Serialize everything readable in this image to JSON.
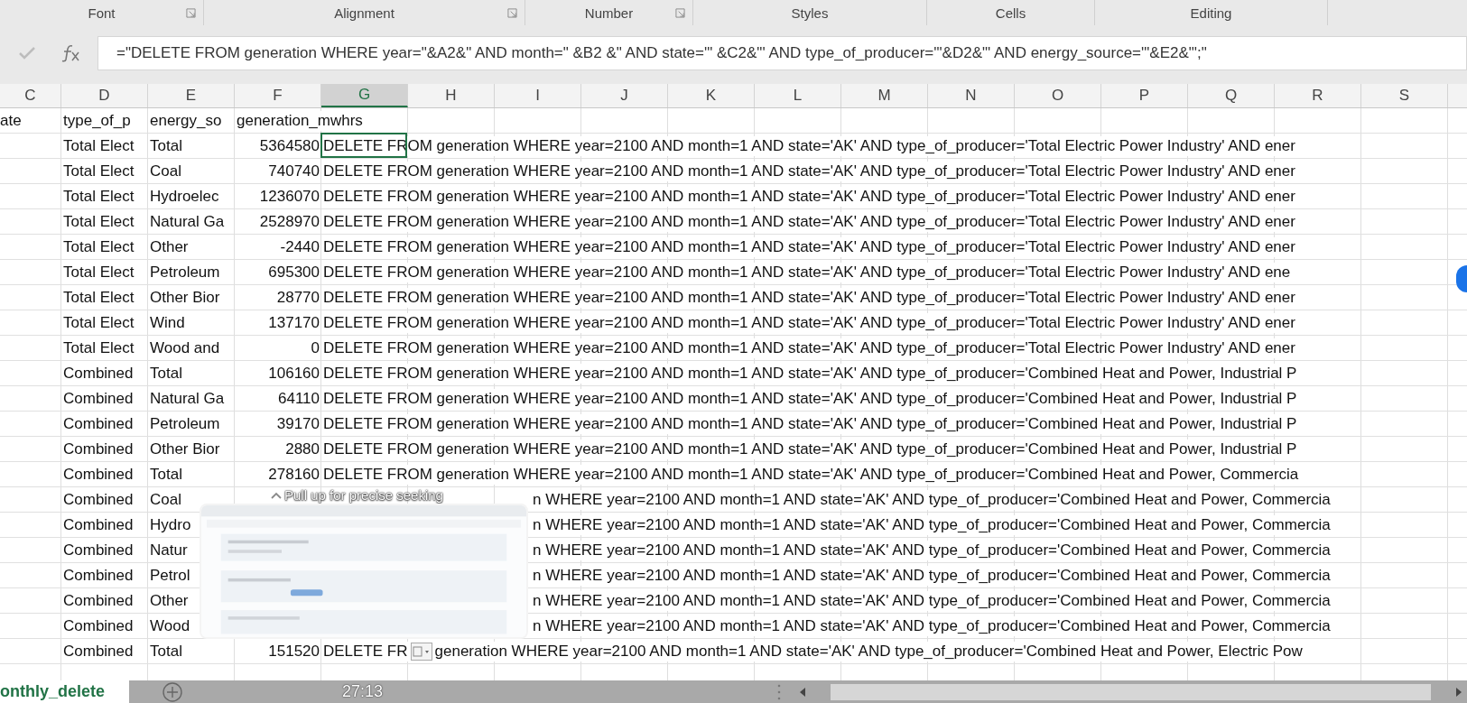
{
  "ribbon_groups": [
    {
      "label": "Font",
      "launcher": true
    },
    {
      "label": "Alignment",
      "launcher": true
    },
    {
      "label": "Number",
      "launcher": true
    },
    {
      "label": "Styles",
      "launcher": false
    },
    {
      "label": "Cells",
      "launcher": false
    },
    {
      "label": "Editing",
      "launcher": false
    }
  ],
  "formula_bar": {
    "formula": "=\"DELETE FROM generation WHERE year=\"&A2&\" AND month=\" &B2 &\" AND state='\" &C2&\"' AND type_of_producer='\"&D2&\"' AND energy_source='\"&E2&\"';\""
  },
  "columns": [
    {
      "label": "C",
      "selected": false
    },
    {
      "label": "D",
      "selected": false
    },
    {
      "label": "E",
      "selected": false
    },
    {
      "label": "F",
      "selected": false
    },
    {
      "label": "G",
      "selected": true
    },
    {
      "label": "H",
      "selected": false
    },
    {
      "label": "I",
      "selected": false
    },
    {
      "label": "J",
      "selected": false
    },
    {
      "label": "K",
      "selected": false
    },
    {
      "label": "L",
      "selected": false
    },
    {
      "label": "M",
      "selected": false
    },
    {
      "label": "N",
      "selected": false
    },
    {
      "label": "O",
      "selected": false
    },
    {
      "label": "P",
      "selected": false
    },
    {
      "label": "Q",
      "selected": false
    },
    {
      "label": "R",
      "selected": false
    },
    {
      "label": "S",
      "selected": false
    }
  ],
  "header_row": [
    "ate",
    "type_of_p",
    "energy_so",
    "generation_mwhrs"
  ],
  "rows": [
    {
      "kind": "plain",
      "producer": "Total Elect",
      "source": "Total",
      "generation": "5364580",
      "sql": "DELETE FROM generation WHERE year=2100 AND month=1 AND state='AK' AND type_of_producer='Total Electric Power Industry' AND ener",
      "selected": true
    },
    {
      "kind": "plain",
      "producer": "Total Elect",
      "source": "Coal",
      "generation": "740740",
      "sql": "DELETE FROM generation WHERE year=2100 AND month=1 AND state='AK' AND type_of_producer='Total Electric Power Industry' AND ener",
      "selected": false
    },
    {
      "kind": "plain",
      "producer": "Total Elect",
      "source": "Hydroelec",
      "generation": "1236070",
      "sql": "DELETE FROM generation WHERE year=2100 AND month=1 AND state='AK' AND type_of_producer='Total Electric Power Industry' AND ener",
      "selected": false
    },
    {
      "kind": "plain",
      "producer": "Total Elect",
      "source": "Natural Ga",
      "generation": "2528970",
      "sql": "DELETE FROM generation WHERE year=2100 AND month=1 AND state='AK' AND type_of_producer='Total Electric Power Industry' AND ener",
      "selected": false
    },
    {
      "kind": "plain",
      "producer": "Total Elect",
      "source": "Other",
      "generation": "-2440",
      "sql": "DELETE FROM generation WHERE year=2100 AND month=1 AND state='AK' AND type_of_producer='Total Electric Power Industry' AND ener",
      "selected": false
    },
    {
      "kind": "plain",
      "producer": "Total Elect",
      "source": "Petroleum",
      "generation": "695300",
      "sql": "DELETE FROM generation WHERE year=2100 AND month=1 AND state='AK' AND type_of_producer='Total Electric Power Industry' AND ene",
      "selected": false
    },
    {
      "kind": "plain",
      "producer": "Total Elect",
      "source": "Other Bior",
      "generation": "28770",
      "sql": "DELETE FROM generation WHERE year=2100 AND month=1 AND state='AK' AND type_of_producer='Total Electric Power Industry' AND ener",
      "selected": false
    },
    {
      "kind": "plain",
      "producer": "Total Elect",
      "source": "Wind",
      "generation": "137170",
      "sql": "DELETE FROM generation WHERE year=2100 AND month=1 AND state='AK' AND type_of_producer='Total Electric Power Industry' AND ener",
      "selected": false
    },
    {
      "kind": "plain",
      "producer": "Total Elect",
      "source": "Wood and",
      "generation": "0",
      "sql": "DELETE FROM generation WHERE year=2100 AND month=1 AND state='AK' AND type_of_producer='Total Electric Power Industry' AND ener",
      "selected": false
    },
    {
      "kind": "plain",
      "producer": "Combined",
      "source": "Total",
      "generation": "106160",
      "sql": "DELETE FROM generation WHERE year=2100 AND month=1 AND state='AK' AND type_of_producer='Combined Heat and Power, Industrial P",
      "selected": false
    },
    {
      "kind": "plain",
      "producer": "Combined",
      "source": "Natural Ga",
      "generation": "64110",
      "sql": "DELETE FROM generation WHERE year=2100 AND month=1 AND state='AK' AND type_of_producer='Combined Heat and Power, Industrial P",
      "selected": false
    },
    {
      "kind": "plain",
      "producer": "Combined",
      "source": "Petroleum",
      "generation": "39170",
      "sql": "DELETE FROM generation WHERE year=2100 AND month=1 AND state='AK' AND type_of_producer='Combined Heat and Power, Industrial P",
      "selected": false
    },
    {
      "kind": "plain",
      "producer": "Combined",
      "source": "Other Bior",
      "generation": "2880",
      "sql": "DELETE FROM generation WHERE year=2100 AND month=1 AND state='AK' AND type_of_producer='Combined Heat and Power, Industrial P",
      "selected": false
    },
    {
      "kind": "plain",
      "producer": "Combined",
      "source": "Total",
      "generation": "278160",
      "sql": "DELETE FROM generation WHERE year=2100 AND month=1 AND state='AK' AND type_of_producer='Combined Heat and Power, Commercia",
      "selected": false
    },
    {
      "kind": "covered",
      "producer": "Combined",
      "source": "Coal",
      "sql": "n WHERE year=2100 AND month=1 AND state='AK' AND type_of_producer='Combined Heat and Power, Commercia",
      "selected": false
    },
    {
      "kind": "covered",
      "producer": "Combined",
      "source": "Hydro",
      "sql": "n WHERE year=2100 AND month=1 AND state='AK' AND type_of_producer='Combined Heat and Power, Commercia",
      "selected": false
    },
    {
      "kind": "covered",
      "producer": "Combined",
      "source": "Natur",
      "sql": "n WHERE year=2100 AND month=1 AND state='AK' AND type_of_producer='Combined Heat and Power, Commercia",
      "selected": false
    },
    {
      "kind": "covered",
      "producer": "Combined",
      "source": "Petrol",
      "sql": "n WHERE year=2100 AND month=1 AND state='AK' AND type_of_producer='Combined Heat and Power, Commercia",
      "selected": false
    },
    {
      "kind": "covered",
      "producer": "Combined",
      "source": "Other",
      "sql": "n WHERE year=2100 AND month=1 AND state='AK' AND type_of_producer='Combined Heat and Power, Commercia",
      "selected": false
    },
    {
      "kind": "covered",
      "producer": "Combined",
      "source": "Wood",
      "sql": "n WHERE year=2100 AND month=1 AND state='AK' AND type_of_producer='Combined Heat and Power, Commercia",
      "selected": false
    },
    {
      "kind": "paste",
      "producer": "Combined",
      "source": "Total",
      "generation": "151520",
      "sql": "DELETE FR",
      "sql_after": "generation WHERE year=2100 AND month=1 AND state='AK' AND type_of_producer='Combined Heat and Power, Electric Pow",
      "selected": false
    }
  ],
  "sheet_tab": {
    "label": "onthly_delete",
    "selected": true
  },
  "video": {
    "seek_hint": "Pull up for precise seeking",
    "time": "27:13"
  }
}
